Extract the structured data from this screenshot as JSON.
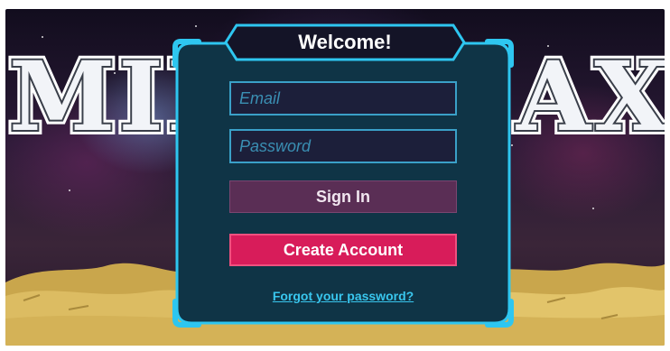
{
  "game": {
    "logo_text": "MIDNIGHT GALAXY",
    "logo_visible_left": "MID",
    "logo_visible_right": "AXY"
  },
  "login": {
    "title": "Welcome!",
    "email_placeholder": "Email",
    "password_placeholder": "Password",
    "signin_label": "Sign In",
    "create_label": "Create Account",
    "forgot_label": "Forgot your password?"
  },
  "colors": {
    "panel": "#0f3446",
    "panel_border": "#2ec6f0",
    "signin": "#5a2e55",
    "create": "#d81c5a",
    "link": "#39c6ee",
    "sand": "#d8b65a"
  }
}
